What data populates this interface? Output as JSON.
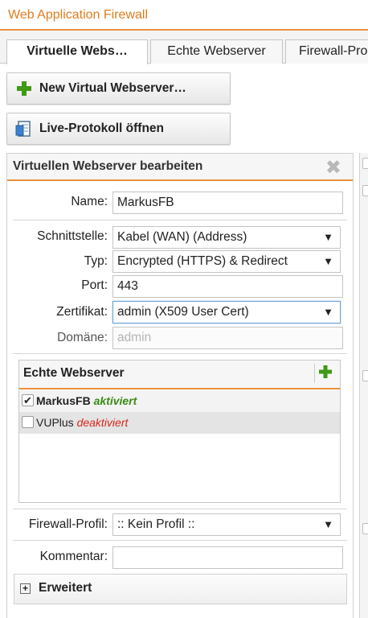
{
  "app": {
    "title": "Web Application Firewall"
  },
  "tabs": [
    {
      "label": "Virtuelle Webs…",
      "active": true
    },
    {
      "label": "Echte Webserver",
      "active": false
    },
    {
      "label": "Firewall-Pro",
      "active": false
    }
  ],
  "toolbar": {
    "new_label": "New Virtual Webserver…",
    "log_label": "Live-Protokoll öffnen"
  },
  "panel": {
    "title": "Virtuellen Webserver bearbeiten",
    "close_glyph": "✖"
  },
  "form": {
    "name": {
      "label": "Name:",
      "value": "MarkusFB"
    },
    "interface": {
      "label": "Schnittstelle:",
      "value": "Kabel (WAN) (Address)"
    },
    "type": {
      "label": "Typ:",
      "value": "Encrypted (HTTPS) & Redirect"
    },
    "port": {
      "label": "Port:",
      "value": "443"
    },
    "certificate": {
      "label": "Zertifikat:",
      "value": "admin (X509 User Cert)"
    },
    "domain": {
      "label": "Domäne:",
      "placeholder": "admin"
    },
    "firewall_profile": {
      "label": "Firewall-Profil:",
      "value": ":: Kein Profil ::"
    },
    "comment": {
      "label": "Kommentar:",
      "value": ""
    },
    "select_arrow": "▼"
  },
  "real_servers": {
    "title": "Echte Webserver",
    "items": [
      {
        "name": "MarkusFB",
        "status": "aktiviert",
        "checked": true,
        "status_color": "#3a8a14"
      },
      {
        "name": "VUPlus",
        "status": "deaktiviert",
        "checked": false,
        "status_color": "#d8261c"
      }
    ]
  },
  "advanced": {
    "label": "Erweitert",
    "toggle": "+"
  },
  "colors": {
    "accent": "#e9903a",
    "title": "#e07d1d",
    "add_green": "#3f9a18"
  }
}
